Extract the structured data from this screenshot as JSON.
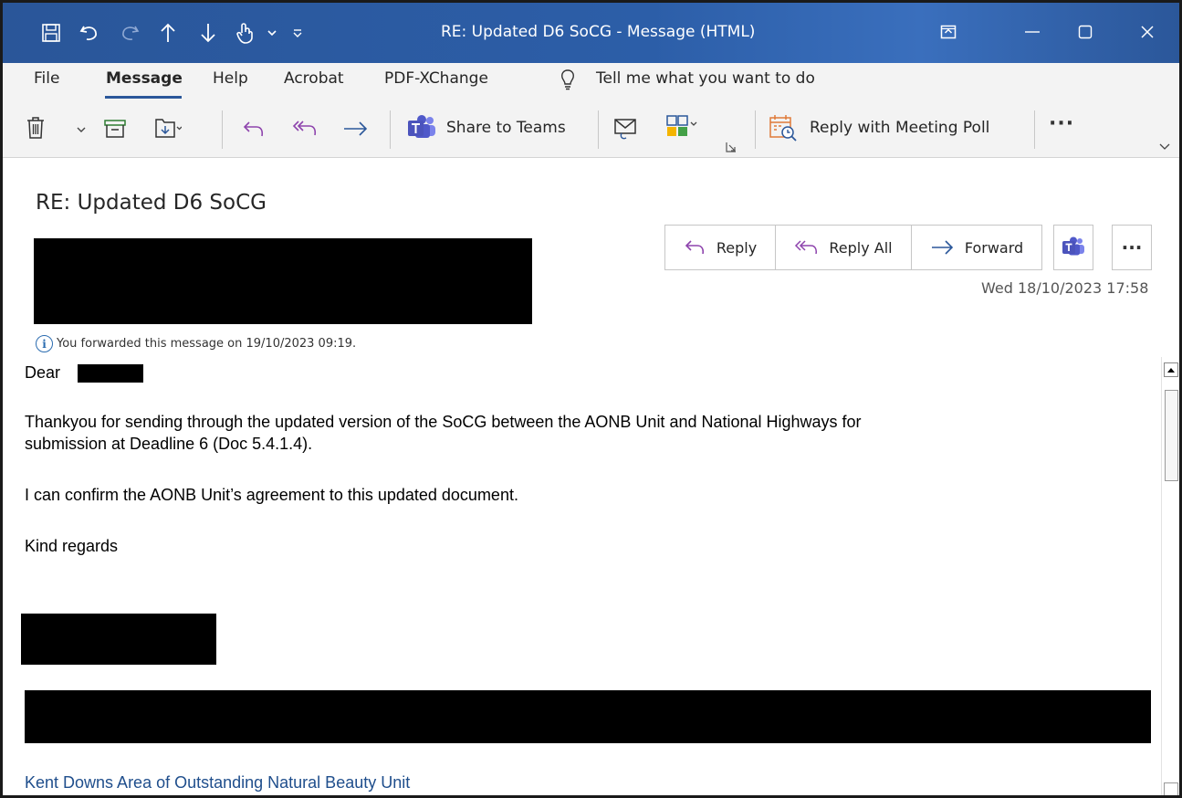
{
  "window": {
    "title": "RE: Updated D6 SoCG  -  Message (HTML)"
  },
  "menu": {
    "file": "File",
    "message": "Message",
    "help": "Help",
    "acrobat": "Acrobat",
    "pdfxchange": "PDF-XChange",
    "tell_me": "Tell me what you want to do"
  },
  "ribbon": {
    "share_to_teams": "Share to Teams",
    "reply_with_meeting_poll": "Reply with Meeting Poll",
    "more": "···"
  },
  "message": {
    "subject": "RE: Updated D6 SoCG",
    "reply": "Reply",
    "reply_all": "Reply All",
    "forward": "Forward",
    "more": "···",
    "date": "Wed 18/10/2023 17:58",
    "info": "You forwarded this message on 19/10/2023 09:19."
  },
  "body": {
    "greeting": "Dear",
    "para1_line1": "Thankyou for sending through the updated version of the SoCG between the AONB Unit and National Highways for",
    "para1_line2": "submission at Deadline 6 (Doc 5.4.1.4).",
    "para2": "I can confirm the AONB Unit’s agreement to this updated document.",
    "closing": "Kind regards",
    "org_link": "Kent Downs Area of Outstanding Natural Beauty Unit"
  },
  "colors": {
    "titlebar": "#2b579a",
    "accent": "#2b579a",
    "link": "#1f4e8c",
    "teams": "#4b53bc"
  }
}
